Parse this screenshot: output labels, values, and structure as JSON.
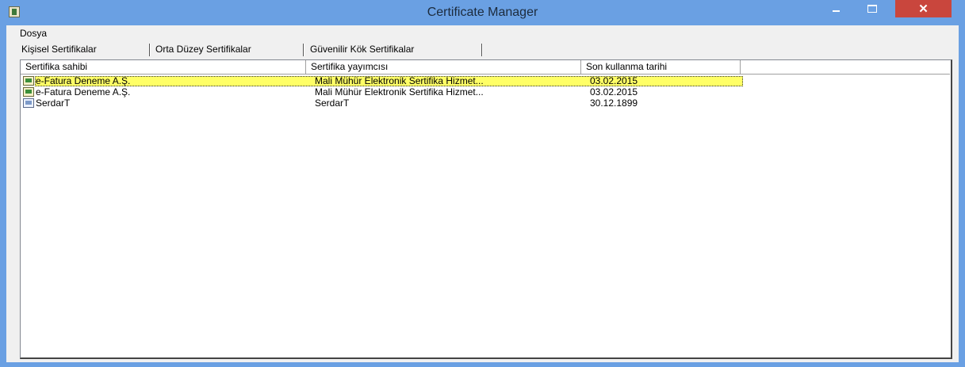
{
  "window": {
    "title": "Certificate Manager"
  },
  "menu": {
    "items": [
      {
        "label": "Dosya"
      }
    ]
  },
  "tabs": [
    {
      "label": "Kişisel Sertifikalar",
      "active": true
    },
    {
      "label": "Orta Düzey Sertifikalar",
      "active": false
    },
    {
      "label": "Güvenilir Kök Sertifikalar",
      "active": false
    }
  ],
  "table": {
    "columns": [
      "Sertifika sahibi",
      "Sertifika yayımcısı",
      "Son kullanma tarihi"
    ],
    "rows": [
      {
        "owner": "e-Fatura Deneme A.Ş.",
        "issuer": "Mali Mühür Elektronik Sertifika Hizmet...",
        "expiry": "03.02.2015",
        "icon": "certificate-icon",
        "selected": true
      },
      {
        "owner": "e-Fatura Deneme A.Ş.",
        "issuer": "Mali Mühür Elektronik Sertifika Hizmet...",
        "expiry": "03.02.2015",
        "icon": "certificate-icon",
        "selected": false
      },
      {
        "owner": "SerdarT",
        "issuer": "SerdarT",
        "expiry": "30.12.1899",
        "icon": "certificate-icon",
        "selected": false
      }
    ]
  },
  "colors": {
    "titlebar": "#6aa0e3",
    "close_button": "#c9463d",
    "selection": "#ffff66"
  }
}
